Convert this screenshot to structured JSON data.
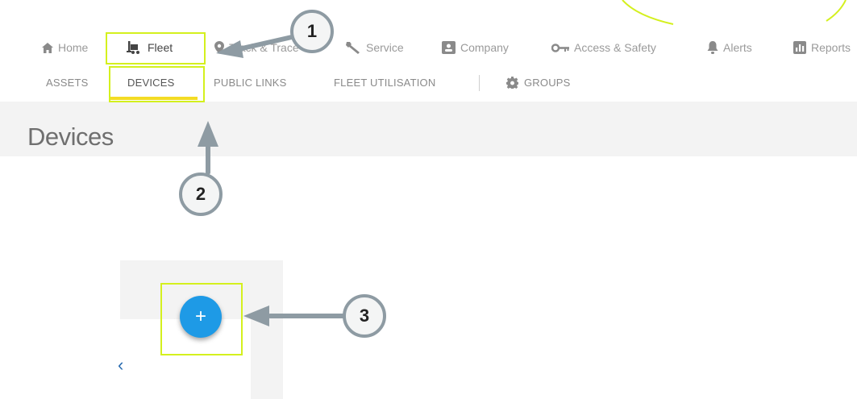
{
  "topnav": {
    "items": [
      {
        "label": "Home",
        "icon": "home-icon"
      },
      {
        "label": "Fleet",
        "icon": "forklift-icon"
      },
      {
        "label": "Track & Trace",
        "icon": "map-pin-icon"
      },
      {
        "label": "Service",
        "icon": "wrench-icon"
      },
      {
        "label": "Company",
        "icon": "company-card-icon"
      },
      {
        "label": "Access & Safety",
        "icon": "key-icon"
      },
      {
        "label": "Alerts",
        "icon": "bell-icon"
      },
      {
        "label": "Reports",
        "icon": "bar-chart-icon"
      }
    ],
    "active": "Fleet"
  },
  "subnav": {
    "items": [
      {
        "label": "ASSETS"
      },
      {
        "label": "DEVICES"
      },
      {
        "label": "PUBLIC LINKS"
      },
      {
        "label": "FLEET UTILISATION"
      },
      {
        "label": "GROUPS",
        "icon": "gear-icon"
      }
    ],
    "active": "DEVICES"
  },
  "page": {
    "title": "Devices"
  },
  "panel": {
    "add_button_symbol": "+",
    "collapse_symbol": "‹"
  },
  "callouts": {
    "one": "1",
    "two": "2",
    "three": "3"
  },
  "colors": {
    "highlight": "#d4f01e",
    "accent_underline": "#f4dc24",
    "fab_blue": "#1e9ae6",
    "callout_border": "#8e9ba3"
  }
}
